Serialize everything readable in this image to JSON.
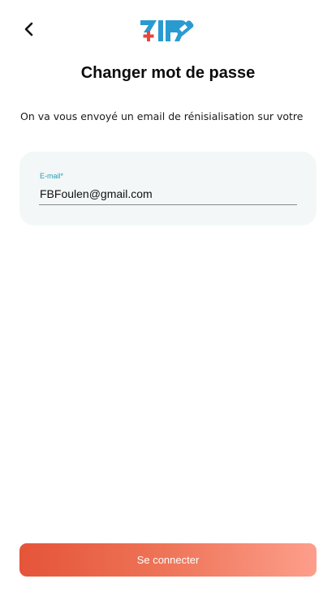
{
  "header": {
    "back_icon": "chevron-left-icon",
    "logo_text": "ZIR",
    "logo_icon": "medical-cross-logo",
    "colors": {
      "logo_blue": "#2a9bd0",
      "logo_red": "#e5473a"
    }
  },
  "page": {
    "title": "Changer mot de passe",
    "description": "On va vous envoyé un email de rénisialisation sur votre"
  },
  "form": {
    "email_label": "E-mail*",
    "email_value": "FBFoulen@gmail.com"
  },
  "actions": {
    "submit_label": "Se connecter",
    "colors": {
      "gradient_start": "#e55439",
      "gradient_end": "#fd9e8b"
    }
  }
}
